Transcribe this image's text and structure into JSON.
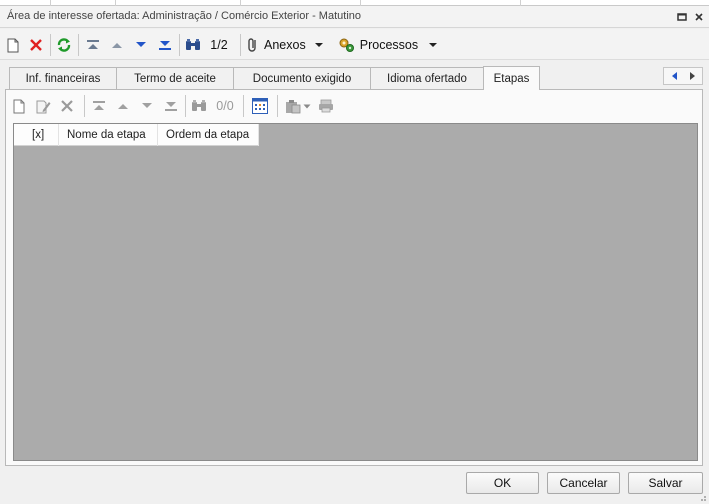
{
  "window": {
    "title": "Área de interesse ofertada: Administração / Comércio Exterior - Matutino"
  },
  "toolbar": {
    "record_position": "1/2",
    "anexos_label": "Anexos",
    "processos_label": "Processos"
  },
  "tabs": [
    {
      "label": "Inf. financeiras"
    },
    {
      "label": "Termo de aceite"
    },
    {
      "label": "Documento exigido"
    },
    {
      "label": "Idioma ofertado"
    },
    {
      "label": "Etapas"
    }
  ],
  "subtoolbar": {
    "record_position": "0/0"
  },
  "grid": {
    "columns": [
      "[x]",
      "Nome da etapa",
      "Ordem da etapa"
    ],
    "rows": []
  },
  "footer": {
    "ok_label": "OK",
    "cancel_label": "Cancelar",
    "save_label": "Salvar"
  },
  "colors": {
    "grid_background": "#ababab",
    "delete_red": "#e02020",
    "refresh_green": "#1f9a2a",
    "nav_blue": "#2255c8"
  },
  "icons": [
    "new-icon",
    "delete-icon",
    "refresh-icon",
    "first-icon",
    "previous-icon",
    "next-icon",
    "last-icon",
    "find-icon",
    "attachment-icon",
    "dropdown-arrow-icon",
    "processes-icon",
    "edit-icon",
    "calendar-grid-icon",
    "clipboard-icon",
    "print-icon",
    "tab-scroll-left-icon",
    "tab-scroll-right-icon",
    "restore-icon",
    "close-icon"
  ]
}
